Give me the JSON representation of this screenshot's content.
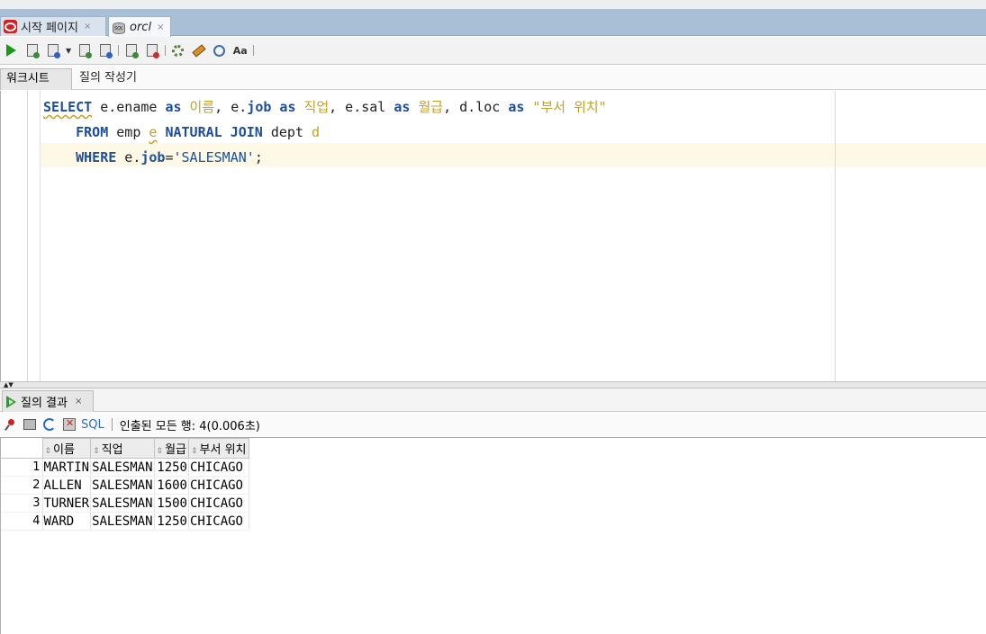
{
  "tabs": [
    {
      "label": "시작 페이지",
      "close": "×",
      "icon": "oracle-icon"
    },
    {
      "label": "orcl",
      "close": "×",
      "icon": "database-sql-icon"
    }
  ],
  "toolbar": {
    "icons": [
      "run-statement-icon",
      "run-script-icon",
      "autotrace-icon",
      "explain-plan-icon",
      "sql-tuning-icon",
      "commit-icon",
      "rollback-icon",
      "unshared-worksheet-icon",
      "clear-icon",
      "history-icon",
      "format-icon"
    ]
  },
  "worksheet_tabs": {
    "active": "워크시트",
    "other": "질의 작성기"
  },
  "editor": {
    "lines": [
      {
        "select": "SELECT",
        "p1": " e.ename ",
        "as1": "as",
        "a1": " 이름",
        "p2": ", e.",
        "job1": "job",
        "sp1": " ",
        "as2": "as",
        "a2": " 직업",
        "p3": ", e.sal ",
        "as3": "as",
        "a3": " 월급",
        "p4": ", d.loc ",
        "as4": "as",
        "a4": " \"부서 위치\""
      },
      {
        "indent": "    ",
        "from": "FROM",
        "p1": " emp ",
        "e": "e",
        "sp": " ",
        "natural": "NATURAL",
        "sp2": " ",
        "join": "JOIN",
        "p2": " dept ",
        "d": "d"
      },
      {
        "indent": "    ",
        "where": "WHERE",
        "p1": " e.",
        "job": "job",
        "eq": "=",
        "str": "'SALESMAN'",
        "semi": ";"
      }
    ]
  },
  "results": {
    "tab_label": "질의 결과",
    "tab_close": "×",
    "sql_label": "SQL",
    "fetch_status": "인출된 모든 행: 4(0.006초)",
    "sort_glyph": "⇕",
    "columns": [
      "이름",
      "직업",
      "월급",
      "부서 위치"
    ],
    "rows": [
      {
        "n": "1",
        "ename": "MARTIN",
        "job": "SALESMAN",
        "sal": "1250",
        "loc": "CHICAGO"
      },
      {
        "n": "2",
        "ename": "ALLEN",
        "job": "SALESMAN",
        "sal": "1600",
        "loc": "CHICAGO"
      },
      {
        "n": "3",
        "ename": "TURNER",
        "job": "SALESMAN",
        "sal": "1500",
        "loc": "CHICAGO"
      },
      {
        "n": "4",
        "ename": "WARD",
        "job": "SALESMAN",
        "sal": "1250",
        "loc": "CHICAGO"
      }
    ]
  }
}
